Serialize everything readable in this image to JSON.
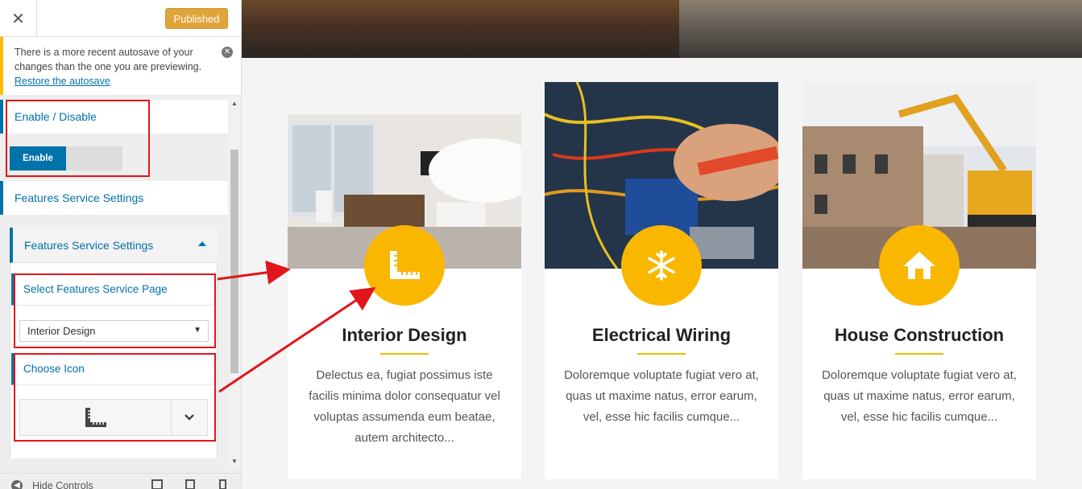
{
  "header": {
    "close_glyph": "✕",
    "published_label": "Published"
  },
  "notice": {
    "message": "There is a more recent autosave of your changes than the one you are previewing.",
    "link": "Restore the autosave"
  },
  "panel": {
    "enable_disable_title": "Enable / Disable",
    "toggle_label": "Enable",
    "features_settings_title": "Features Service Settings",
    "sub_section_title": "Features Service Settings",
    "select_page_title": "Select Features Service Page",
    "select_page_value": "Interior Design",
    "choose_icon_title": "Choose Icon",
    "selected_icon": "ruler-icon"
  },
  "footer": {
    "hide_controls_label": "Hide Controls"
  },
  "cards": [
    {
      "title": "Interior Design",
      "text": "Delectus ea, fugiat possimus iste facilis minima dolor consequatur vel voluptas assumenda eum beatae, autem architecto...",
      "icon": "ruler-icon"
    },
    {
      "title": "Electrical Wiring",
      "text": "Doloremque voluptate fugiat vero at, quas ut maxime natus, error earum, vel, esse hic facilis cumque...",
      "icon": "snowflake-icon"
    },
    {
      "title": "House Construction",
      "text": "Doloremque voluptate fugiat vero at, quas ut maxime natus, error earum, vel, esse hic facilis cumque...",
      "icon": "home-icon"
    }
  ],
  "colors": {
    "accent": "#f9b700",
    "link": "#0073aa",
    "highlight": "#e0161b",
    "notice": "#ffb900"
  }
}
